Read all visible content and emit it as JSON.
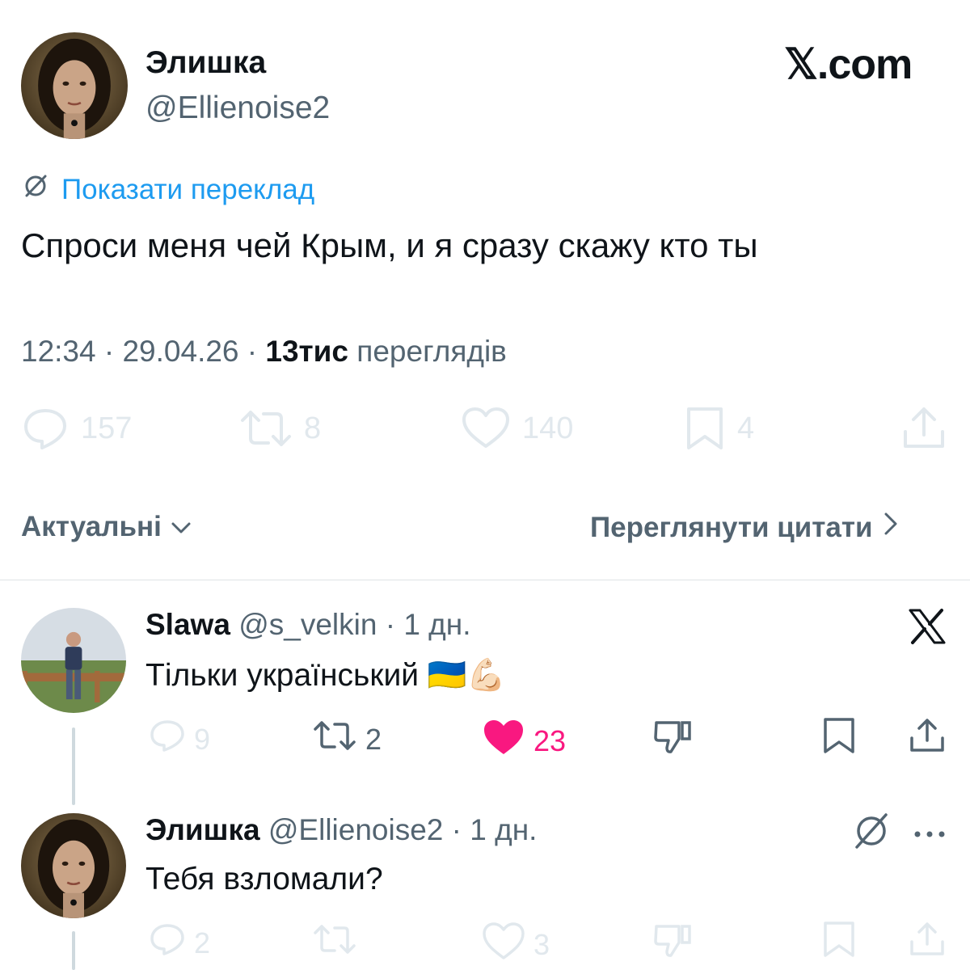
{
  "tweet": {
    "author_name": "Элишка",
    "author_handle": "@Ellienoise2",
    "brand": "𝕏.com",
    "translate_label": "Показати переклад",
    "text": "Спроси меня чей Крым, и я сразу скажу кто ты",
    "time": "12:34",
    "date": "29.04.26",
    "views_count": "13тис",
    "views_label": "переглядів",
    "stats": {
      "replies": "157",
      "reposts": "8",
      "likes": "140",
      "bookmarks": "4"
    }
  },
  "sort_bar": {
    "sort_label": "Актуальні",
    "quotes_label": "Переглянути цитати"
  },
  "replies": [
    {
      "name": "Slawa",
      "handle": "@s_velkin",
      "age": "1 дн.",
      "text": "Тільки український 🇺🇦💪🏻",
      "stats": {
        "replies": "9",
        "reposts": "2",
        "likes": "23"
      },
      "liked": true,
      "badge_icon": "x-logo-icon"
    },
    {
      "name": "Элишка",
      "handle": "@Ellienoise2",
      "age": "1 дн.",
      "text": "Тебя взломали?",
      "stats": {
        "replies": "2",
        "reposts": "",
        "likes": "3"
      },
      "liked": false,
      "badge_icon": "translate-icon"
    }
  ],
  "colors": {
    "accent": "#1d9bf0",
    "like": "#f91880",
    "secondary_text": "#536471"
  }
}
